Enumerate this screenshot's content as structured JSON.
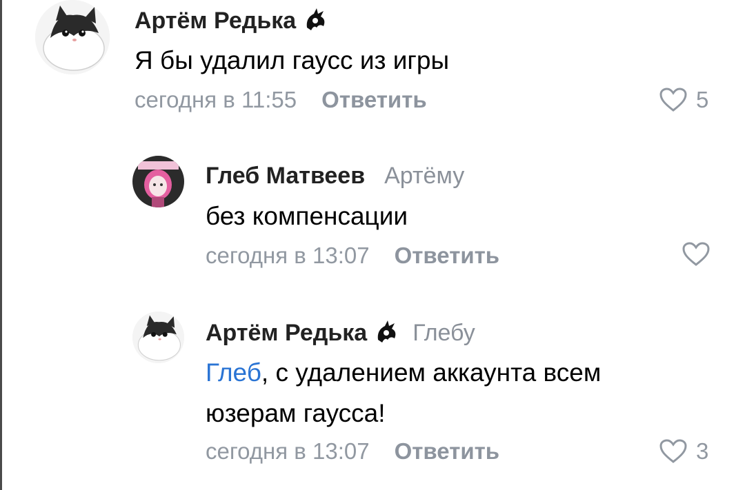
{
  "comments": [
    {
      "author": "Артём Редька",
      "reply_to": "",
      "text": "Я бы удалил гаусс из игры",
      "date": "сегодня в 11:55",
      "reply_label": "Ответить",
      "likes": "5"
    },
    {
      "author": "Глеб Матвеев",
      "reply_to": "Артёму",
      "text": "без компенсации",
      "date": "сегодня в 13:07",
      "reply_label": "Ответить",
      "likes": ""
    },
    {
      "author": "Артём Редька",
      "reply_to": "Глебу",
      "mention": "Глеб",
      "text_line1": ", с удалением аккаунта всем",
      "text_line2": "юзерам гаусса!",
      "date": "сегодня в 13:07",
      "reply_label": "Ответить",
      "likes": "3"
    }
  ],
  "colors": {
    "author": "#222222",
    "meta": "#9198a1",
    "mention": "#2a74d4"
  },
  "icons": [
    "cat-avatar",
    "anime-avatar",
    "dragon-badge-icon",
    "heart-icon"
  ]
}
